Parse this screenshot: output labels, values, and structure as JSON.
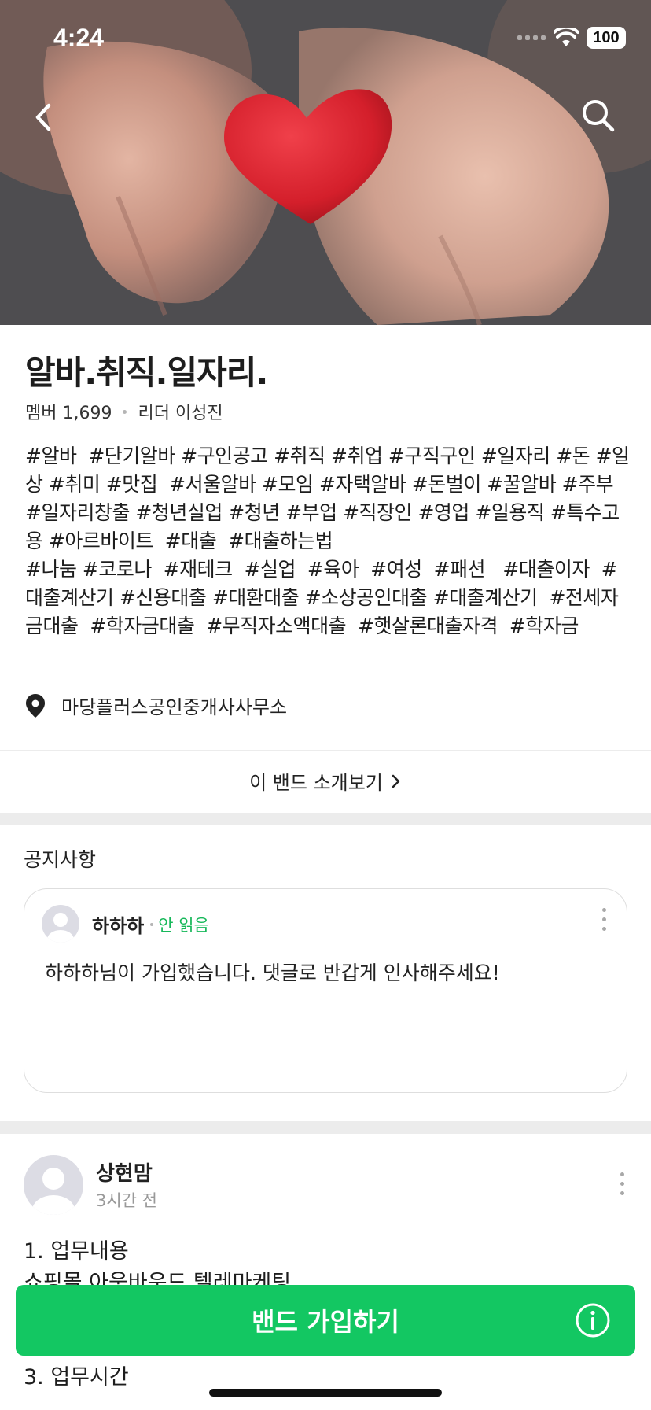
{
  "status_bar": {
    "time": "4:24",
    "battery": "100"
  },
  "band": {
    "title": "알바.취직.일자리.",
    "members_label": "멤버 1,699",
    "leader_label": "리더 이성진",
    "description": "#알바  #단기알바 #구인공고 #취직 #취업 #구직구인 #일자리 #돈 #일상 #취미 #맛집  #서울알바 #모임 #자택알바 #돈벌이 #꿀알바 #주부 #일자리창출 #청년실업 #청년 #부업 #직장인 #영업 #일용직 #특수고용 #아르바이트  #대출  #대출하는법\n#나눔 #코로나  #재테크  #실업  #육아  #여성  #패션   #대출이자  #대출계산기 #신용대출 #대환대출 #소상공인대출 #대출계산기  #전세자금대출  #학자금대출  #무직자소액대출  #햇살론대출자격  #학자금",
    "location": "마당플러스공인중개사사무소",
    "intro_link": "이 밴드 소개보기"
  },
  "notice": {
    "section_title": "공지사항",
    "author": "하하하",
    "status": "안 읽음",
    "text": "하하하님이 가입했습니다. 댓글로 반갑게 인사해주세요!"
  },
  "post": {
    "author": "상현맘",
    "time": "3시간 전",
    "body": "1. 업무내용\n쇼핑몰 아웃바운드 텔레마케팅\n\n텔레마케팅 경력자 우대\n3. 업무시간"
  },
  "join_button": {
    "label": "밴드 가입하기"
  },
  "colors": {
    "accent_green": "#13c762",
    "unread_green": "#17b85a",
    "section_gap": "#ececec"
  },
  "icons": [
    "back-arrow-icon",
    "search-icon",
    "location-pin-icon",
    "chevron-right-icon",
    "more-vertical-icon",
    "info-icon",
    "wifi-icon"
  ]
}
